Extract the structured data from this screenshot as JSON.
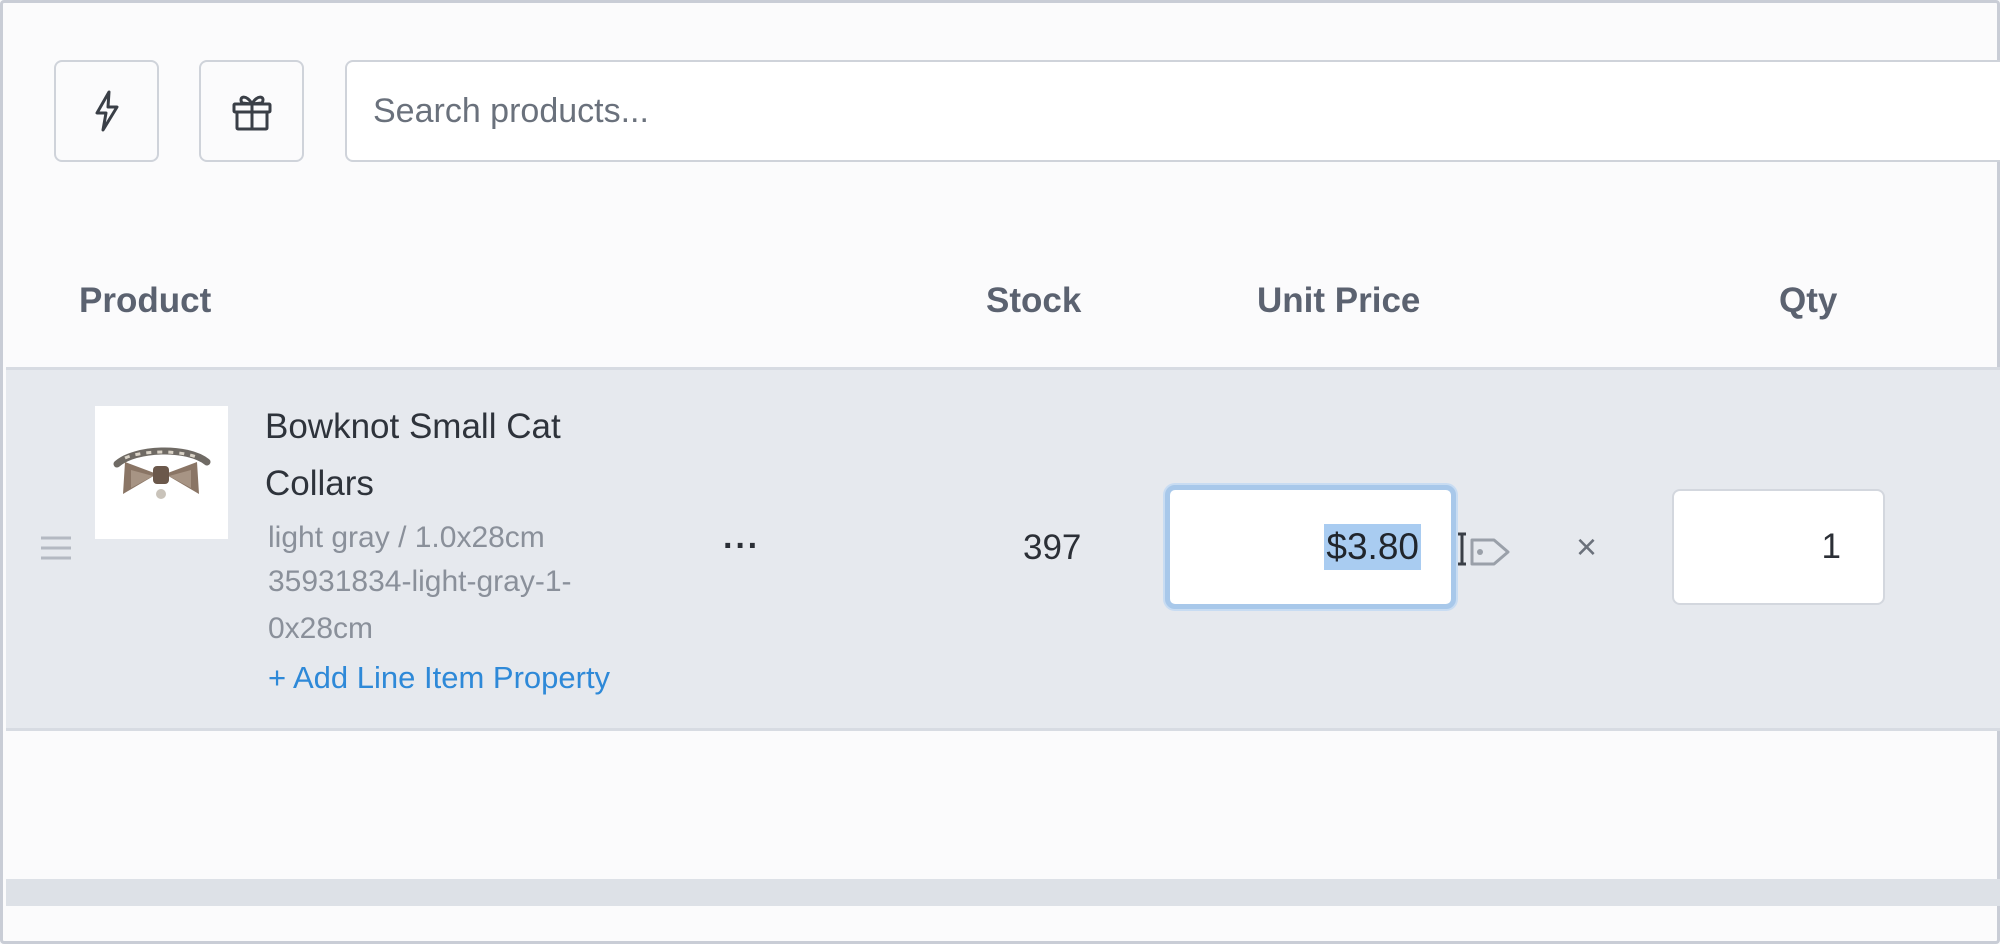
{
  "toolbar": {
    "quick_action_icon": "lightning-icon",
    "gift_icon": "gift-icon"
  },
  "search": {
    "placeholder": "Search products..."
  },
  "table": {
    "headers": {
      "product": "Product",
      "stock": "Stock",
      "unit_price": "Unit Price",
      "qty": "Qty"
    },
    "rows": [
      {
        "name": "Bowknot Small Cat Collars",
        "variant": "light gray / 1.0x28cm",
        "sku": "35931834-light-gray-1-0x28cm",
        "add_property_label": "+ Add Line Item Property",
        "more_label": "···",
        "stock": "397",
        "unit_price": "$3.80",
        "times_label": "×",
        "qty": "1"
      }
    ]
  },
  "colors": {
    "accent_link": "#2e89d8",
    "selected_row": "#e6e9ee",
    "focus_ring": "#a8c8ea",
    "text_selection": "#a9ccf1"
  }
}
